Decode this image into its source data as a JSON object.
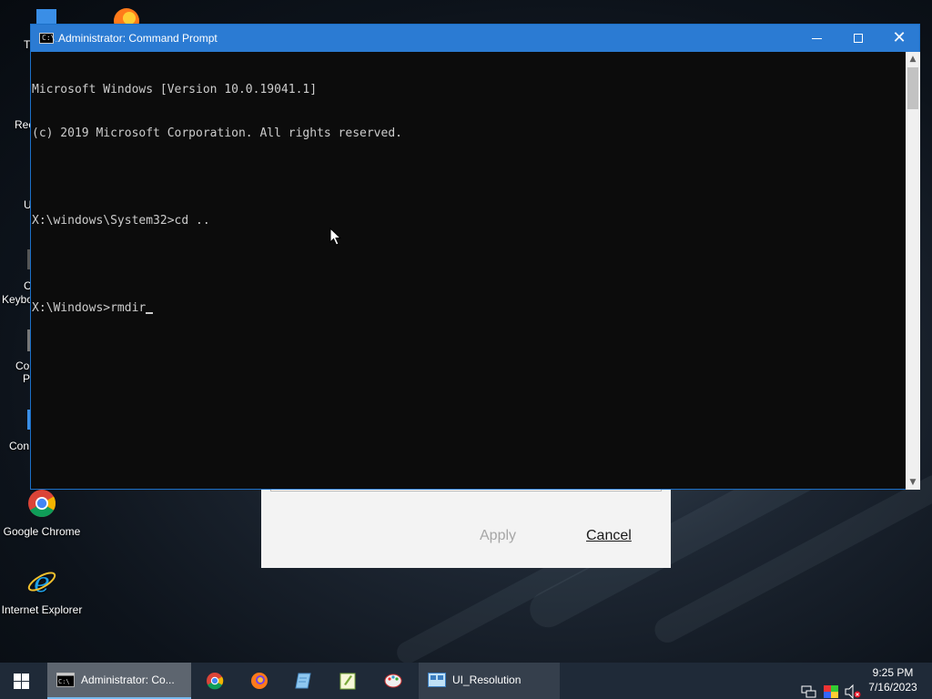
{
  "desktop": {
    "icons": [
      {
        "name": "google-chrome",
        "label": "Google Chrome"
      },
      {
        "name": "internet-explorer",
        "label": "Internet Explorer"
      }
    ],
    "partial_labels": [
      "T",
      "Rec",
      "U",
      "C",
      "Keybo",
      "Co",
      "P",
      "Con"
    ]
  },
  "background_dialog": {
    "apply_label": "Apply",
    "cancel_label": "Cancel"
  },
  "cmd_window": {
    "title": "Administrator: Command Prompt",
    "icon_glyph": "C:\\_",
    "lines": [
      "Microsoft Windows [Version 10.0.19041.1]",
      "(c) 2019 Microsoft Corporation. All rights reserved.",
      "",
      "X:\\windows\\System32>cd ..",
      "",
      "X:\\Windows>rmdir"
    ],
    "controls": {
      "minimize": "minimize",
      "maximize": "maximize",
      "close": "✕"
    }
  },
  "taskbar": {
    "apps": [
      {
        "name": "cmd",
        "label": "Administrator: Co...",
        "active": true
      },
      {
        "name": "ui-resolution",
        "label": "UI_Resolution",
        "active": false
      }
    ],
    "pinned": [
      "chrome-icon",
      "firefox-icon",
      "notepad-icon",
      "notepadpp-icon",
      "paint-icon"
    ],
    "clock": {
      "time": "9:25 PM",
      "date": "7/16/2023"
    },
    "tray_icons": [
      "network-icon",
      "color-icon",
      "volume-muted-icon"
    ]
  },
  "colors": {
    "titlebar": "#2b7bd3",
    "console_bg": "#0c0c0c",
    "console_text": "#cccccc",
    "taskbar": "#1f2a38"
  }
}
